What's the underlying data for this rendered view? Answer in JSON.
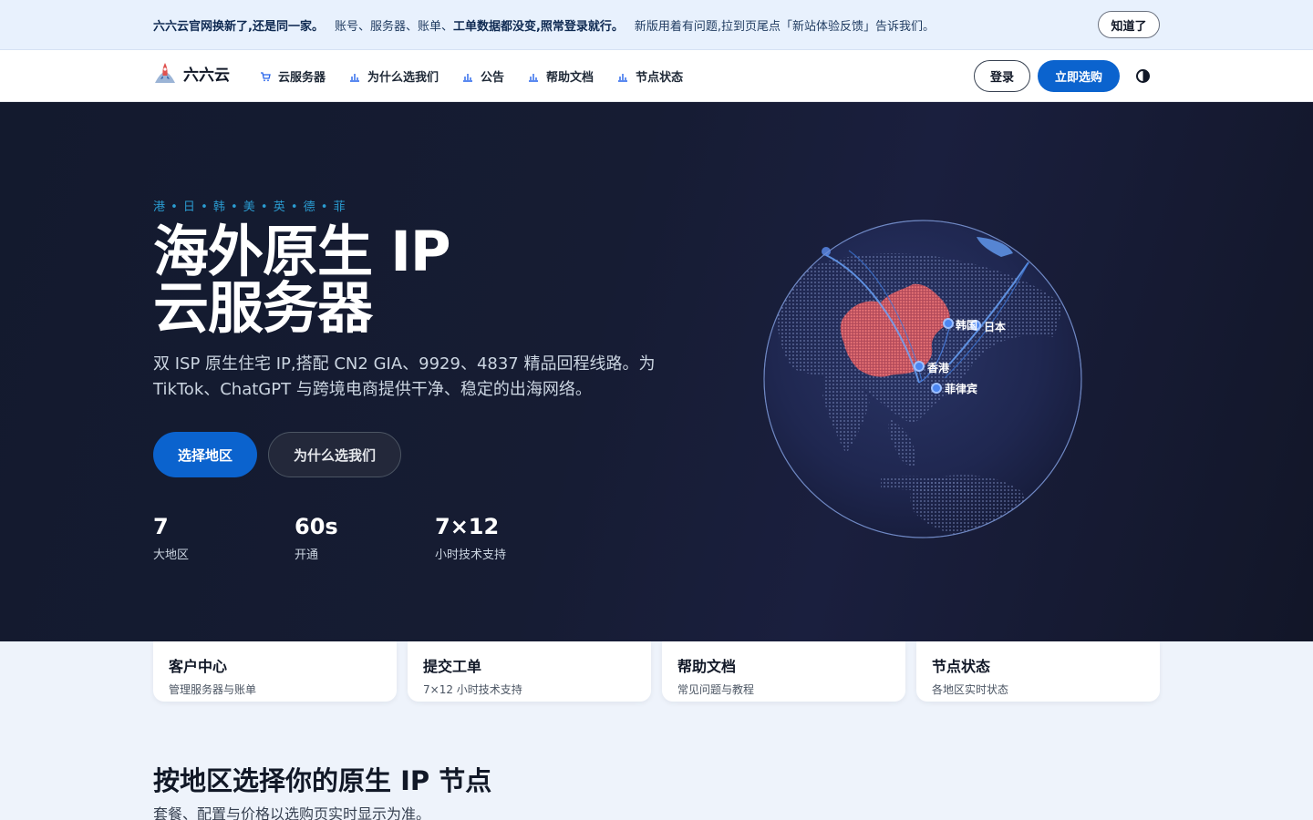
{
  "notice": {
    "bold": "六六云官网换新了,还是同一家。",
    "part2_a": "账号、服务器、账单、",
    "part2_bold": "工单数据都没变,照常登录就行。",
    "part3": "新版用着有问题,拉到页尾点「新站体验反馈」告诉我们。",
    "dismiss": "知道了"
  },
  "nav": {
    "brand": "六六云",
    "items": [
      {
        "label": "云服务器",
        "icon": "cart-icon"
      },
      {
        "label": "为什么选我们",
        "icon": "bar-chart-icon"
      },
      {
        "label": "公告",
        "icon": "bar-chart-icon"
      },
      {
        "label": "帮助文档",
        "icon": "bar-chart-icon"
      },
      {
        "label": "节点状态",
        "icon": "bar-chart-icon"
      }
    ],
    "login": "登录",
    "buy": "立即选购"
  },
  "hero": {
    "tags": "港 • 日 • 韩 • 美 • 英 • 德 • 菲",
    "title_line1": "海外原生 IP",
    "title_line2": "云服务器",
    "description": "双 ISP 原生住宅 IP,搭配 CN2 GIA、9929、4837 精品回程线路。为 TikTok、ChatGPT 与跨境电商提供干净、稳定的出海网络。",
    "primary_button": "选择地区",
    "secondary_button": "为什么选我们",
    "stats": [
      {
        "value": "7",
        "label": "大地区"
      },
      {
        "value": "60s",
        "label": "开通"
      },
      {
        "value": "7×12",
        "label": "小时技术支持"
      }
    ],
    "globe_labels": {
      "korea": "韩国",
      "japan": "日本",
      "hongkong": "香港",
      "philippines": "菲律宾"
    }
  },
  "cards": [
    {
      "title": "客户中心",
      "subtitle": "管理服务器与账单"
    },
    {
      "title": "提交工单",
      "subtitle": "7×12 小时技术支持"
    },
    {
      "title": "帮助文档",
      "subtitle": "常见问题与教程"
    },
    {
      "title": "节点状态",
      "subtitle": "各地区实时状态"
    }
  ],
  "section": {
    "title": "按地区选择你的原生 IP 节点",
    "subtitle": "套餐、配置与价格以选购页实时显示为准。"
  },
  "colors": {
    "accent": "#0b63ce",
    "hero_bg": "#151b31",
    "tag_blue": "#2a9bd0",
    "china_red": "#e05a5a"
  }
}
